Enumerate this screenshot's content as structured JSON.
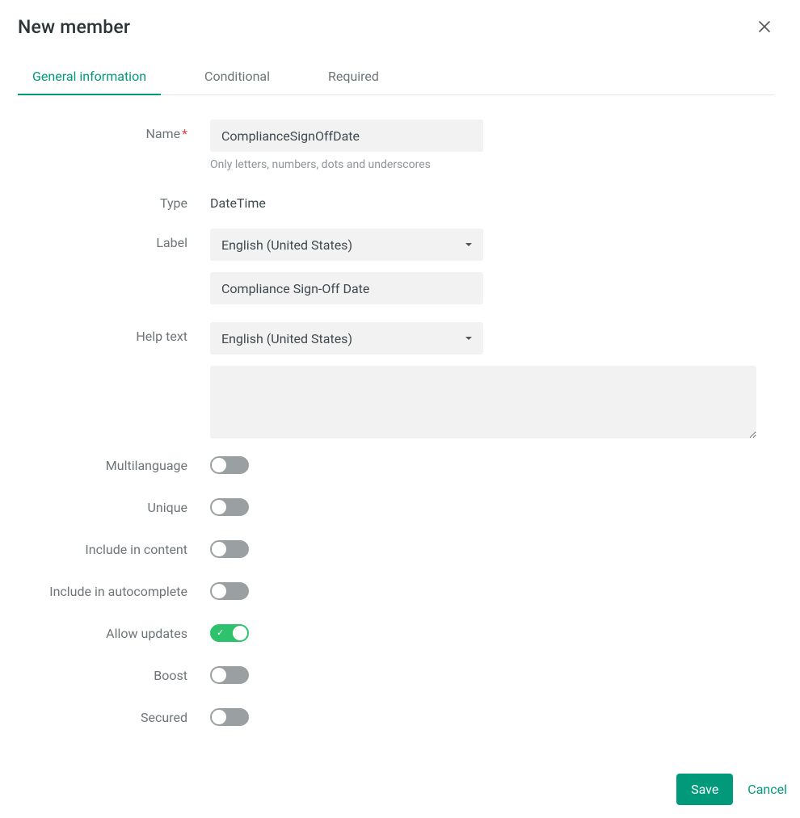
{
  "header": {
    "title": "New member"
  },
  "tabs": {
    "general": "General information",
    "conditional": "Conditional",
    "required": "Required",
    "active": "general"
  },
  "form": {
    "name_label": "Name",
    "name_value": "ComplianceSignOffDate",
    "name_helper": "Only letters, numbers, dots and underscores",
    "type_label": "Type",
    "type_value": "DateTime",
    "label_label": "Label",
    "label_lang": "English (United States)",
    "label_value": "Compliance Sign-Off Date",
    "help_label": "Help text",
    "help_lang": "English (United States)",
    "help_value": "",
    "toggles": {
      "multilanguage": {
        "label": "Multilanguage",
        "on": false
      },
      "unique": {
        "label": "Unique",
        "on": false
      },
      "include_content": {
        "label": "Include in content",
        "on": false
      },
      "include_autocomplete": {
        "label": "Include in autocomplete",
        "on": false
      },
      "allow_updates": {
        "label": "Allow updates",
        "on": true
      },
      "boost": {
        "label": "Boost",
        "on": false
      },
      "secured": {
        "label": "Secured",
        "on": false
      }
    }
  },
  "footer": {
    "save": "Save",
    "cancel": "Cancel"
  }
}
